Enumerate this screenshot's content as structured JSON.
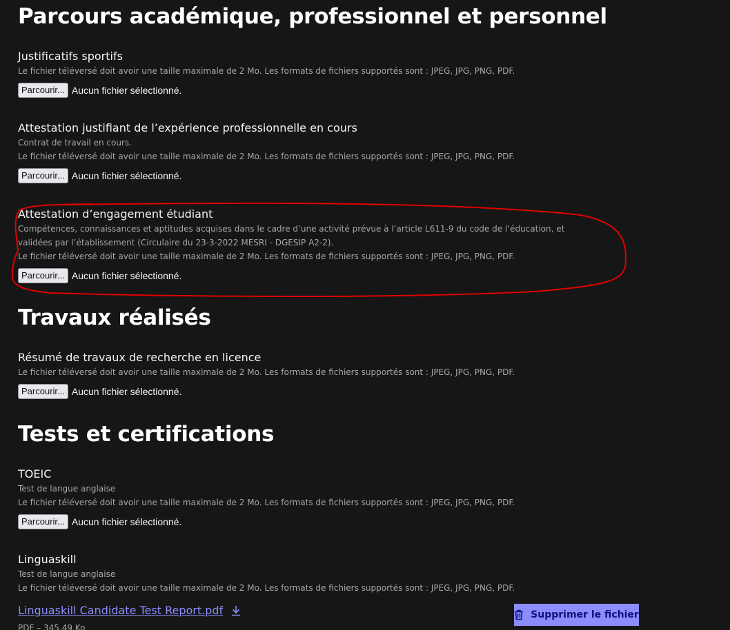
{
  "sections": [
    {
      "title": "Parcours académique, professionnel et personnel",
      "fields": [
        {
          "label": "Justificatifs sportifs",
          "hints": [
            "Le fichier téléversé doit avoir une taille maximale de 2 Mo. Les formats de fichiers supportés sont : JPEG, JPG, PNG, PDF."
          ],
          "browse": "Parcourir...",
          "status": "Aucun fichier sélectionné."
        },
        {
          "label": "Attestation justifiant de l’expérience professionnelle en cours",
          "hints": [
            "Contrat de travail en cours.",
            "Le fichier téléversé doit avoir une taille maximale de 2 Mo. Les formats de fichiers supportés sont : JPEG, JPG, PNG, PDF."
          ],
          "browse": "Parcourir...",
          "status": "Aucun fichier sélectionné."
        },
        {
          "label": "Attestation d’engagement étudiant",
          "hints": [
            "Compétences, connaissances et aptitudes acquises dans le cadre d’une activité prévue à l’article L611-9 du code de l’éducation, et validées par l’établissement (Circulaire du 23-3-2022 MESRI - DGESIP A2-2).",
            "Le fichier téléversé doit avoir une taille maximale de 2 Mo. Les formats de fichiers supportés sont : JPEG, JPG, PNG, PDF."
          ],
          "browse": "Parcourir...",
          "status": "Aucun fichier sélectionné."
        }
      ]
    },
    {
      "title": "Travaux réalisés",
      "fields": [
        {
          "label": "Résumé de travaux de recherche en licence",
          "hints": [
            "Le fichier téléversé doit avoir une taille maximale de 2 Mo. Les formats de fichiers supportés sont : JPEG, JPG, PNG, PDF."
          ],
          "browse": "Parcourir...",
          "status": "Aucun fichier sélectionné."
        }
      ]
    },
    {
      "title": "Tests et certifications",
      "fields": [
        {
          "label": "TOEIC",
          "hints": [
            "Test de langue anglaise",
            "Le fichier téléversé doit avoir une taille maximale de 2 Mo. Les formats de fichiers supportés sont : JPEG, JPG, PNG, PDF."
          ],
          "browse": "Parcourir...",
          "status": "Aucun fichier sélectionné."
        },
        {
          "label": "Linguaskill",
          "hints": [
            "Test de langue anglaise",
            "Le fichier téléversé doit avoir une taille maximale de 2 Mo. Les formats de fichiers supportés sont : JPEG, JPG, PNG, PDF."
          ],
          "uploaded_file": {
            "name": "Linguaskill Candidate Test Report.pdf",
            "meta": "PDF – 345,49 Ko"
          },
          "delete_label": "Supprimer le fichier"
        }
      ]
    }
  ],
  "icons": {
    "download": "download-icon",
    "delete": "trash-icon"
  },
  "colors": {
    "background": "#161616",
    "accent": "#8b8dff",
    "annotation": "#e00000"
  }
}
